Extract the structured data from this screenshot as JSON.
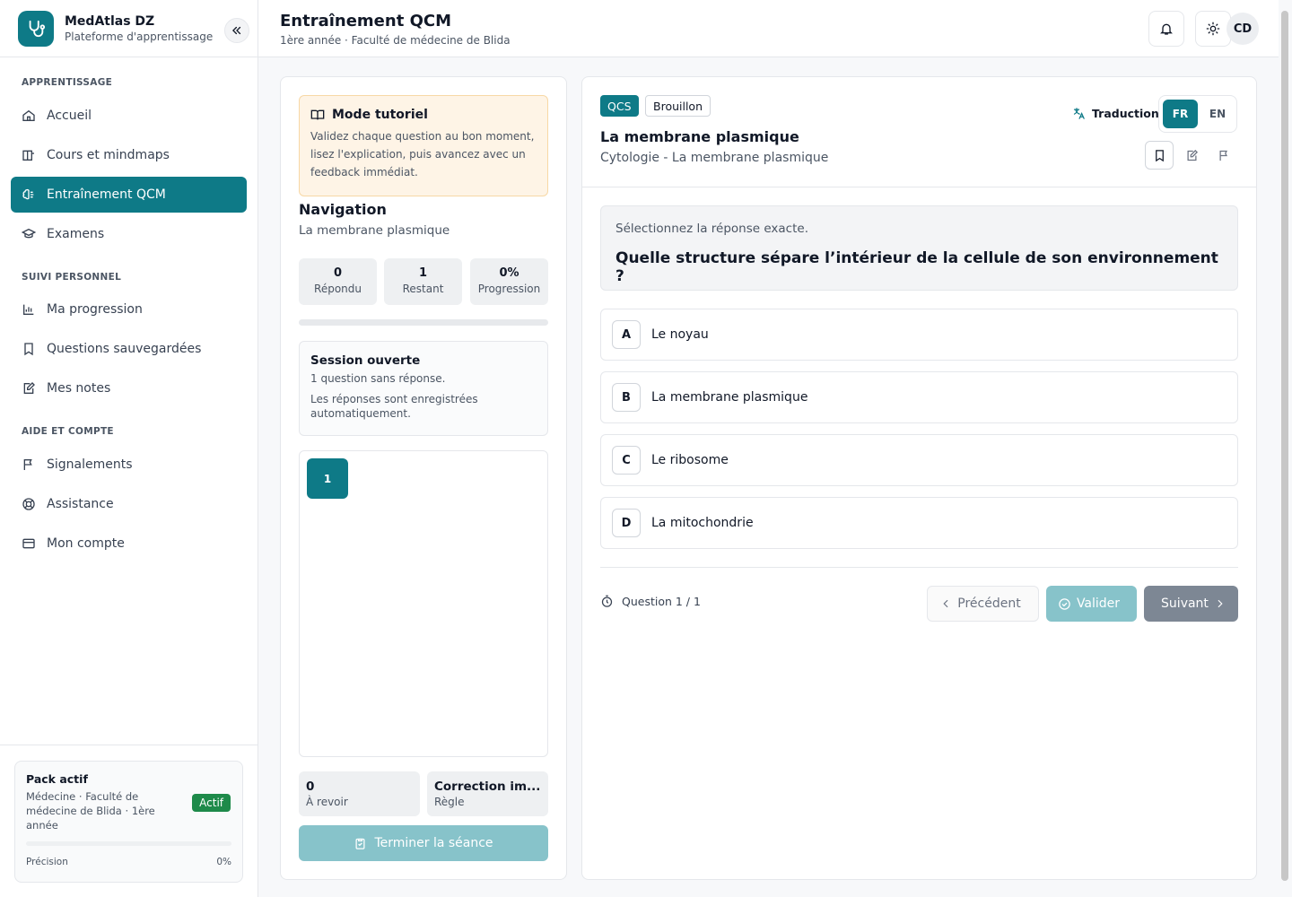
{
  "brand": {
    "name": "MedAtlas DZ",
    "subtitle": "Plateforme d'apprentissage"
  },
  "sidebar": {
    "sections": [
      {
        "title": "APPRENTISSAGE"
      },
      {
        "title": "SUIVI PERSONNEL"
      },
      {
        "title": "AIDE ET COMPTE"
      }
    ],
    "items": [
      {
        "label": "Accueil",
        "icon": "home-icon"
      },
      {
        "label": "Cours et mindmaps",
        "icon": "book-icon"
      },
      {
        "label": "Entraînement QCM",
        "icon": "brain-icon",
        "active": true
      },
      {
        "label": "Examens",
        "icon": "graduation-cap-icon"
      },
      {
        "label": "Ma progression",
        "icon": "bar-chart-icon"
      },
      {
        "label": "Questions sauvegardées",
        "icon": "bookmark-icon"
      },
      {
        "label": "Mes notes",
        "icon": "note-icon"
      },
      {
        "label": "Signalements",
        "icon": "flag-icon"
      },
      {
        "label": "Assistance",
        "icon": "lifebuoy-icon"
      },
      {
        "label": "Mon compte",
        "icon": "card-icon"
      }
    ],
    "pack": {
      "title": "Pack actif",
      "description": "Médecine · Faculté de médecine de Blida · 1ère année",
      "badge": "Actif",
      "precision_label": "Précision",
      "precision_value": "0%",
      "precision_fraction": 0
    }
  },
  "header": {
    "title": "Entraînement QCM",
    "subtitle": "1ère année · Faculté de médecine de Blida",
    "avatar": "CD"
  },
  "tutorial": {
    "title": "Mode tutoriel",
    "text": "Validez chaque question au bon moment, lisez l'explication, puis avancez avec un feedback immédiat."
  },
  "navigation": {
    "title": "Navigation",
    "subtitle": "La membrane plasmique",
    "stats": [
      {
        "value": "0",
        "label": "Répondu"
      },
      {
        "value": "1",
        "label": "Restant"
      },
      {
        "value": "0%",
        "label": "Progression"
      }
    ],
    "progress_fraction": 0,
    "session": {
      "title": "Session ouverte",
      "line1": "1 question sans réponse.",
      "line2": "Les réponses sont enregistrées automatiquement."
    },
    "questions": [
      "1"
    ],
    "review": {
      "value": "0",
      "label": "À revoir"
    },
    "rule": {
      "value": "Correction im...",
      "label": "Règle"
    },
    "finish_label": "Terminer la séance"
  },
  "question": {
    "type_tag": "QCS",
    "status_tag": "Brouillon",
    "title": "La membrane plasmique",
    "topic": "Cytologie - La membrane plasmique",
    "translation_label": "Traduction",
    "languages": [
      "FR",
      "EN"
    ],
    "active_language": "FR",
    "instruction": "Sélectionnez la réponse exacte.",
    "stem": "Quelle structure sépare l’intérieur de la cellule de son environnement ?",
    "options": [
      {
        "key": "A",
        "text": "Le noyau"
      },
      {
        "key": "B",
        "text": "La membrane plasmique"
      },
      {
        "key": "C",
        "text": "Le ribosome"
      },
      {
        "key": "D",
        "text": "La mitochondrie"
      }
    ],
    "counter": "Question 1 / 1",
    "prev_label": "Précédent",
    "validate_label": "Valider",
    "next_label": "Suivant"
  },
  "colors": {
    "primary": "#0e7a87",
    "primary_light": "#87c3ca",
    "tutorial_bg": "#fef4e6",
    "success": "#1e8a4a"
  }
}
